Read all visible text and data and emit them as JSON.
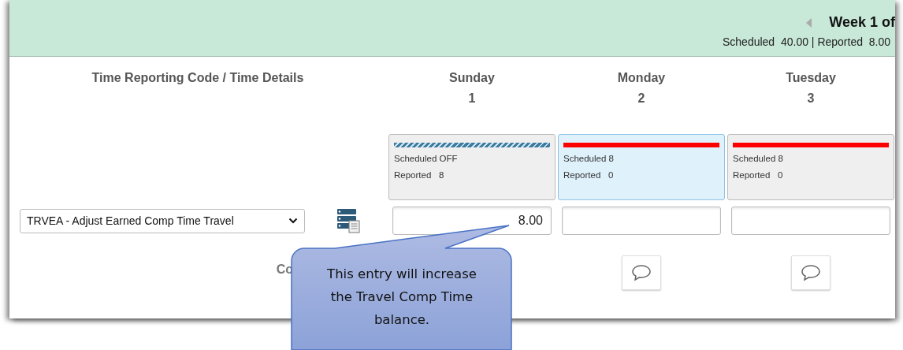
{
  "header": {
    "week_label": "Week 1 of",
    "summary": "Scheduled  40.00 | Reported  8.00"
  },
  "code_column_heading": "Time Reporting Code / Time Details",
  "days": [
    {
      "name": "Sunday",
      "date": "1",
      "kind": "off",
      "selected": false,
      "scheduled": "Scheduled OFF",
      "reported": "Reported   8",
      "hours": "8.00"
    },
    {
      "name": "Monday",
      "date": "2",
      "kind": "work",
      "selected": true,
      "scheduled": "Scheduled 8",
      "reported": "Reported   0"
    },
    {
      "name": "Tuesday",
      "date": "3",
      "kind": "work",
      "selected": false,
      "scheduled": "Scheduled 8",
      "reported": "Reported   0"
    }
  ],
  "time_reporting_code": "TRVEA - Adjust Earned Comp Time Travel",
  "comments_label": "Co",
  "comment_cells": [
    {
      "kind": "covered"
    },
    {
      "kind": "button"
    },
    {
      "kind": "button"
    }
  ],
  "callout": {
    "text": "This entry will increase the Travel Comp Time balance."
  }
}
